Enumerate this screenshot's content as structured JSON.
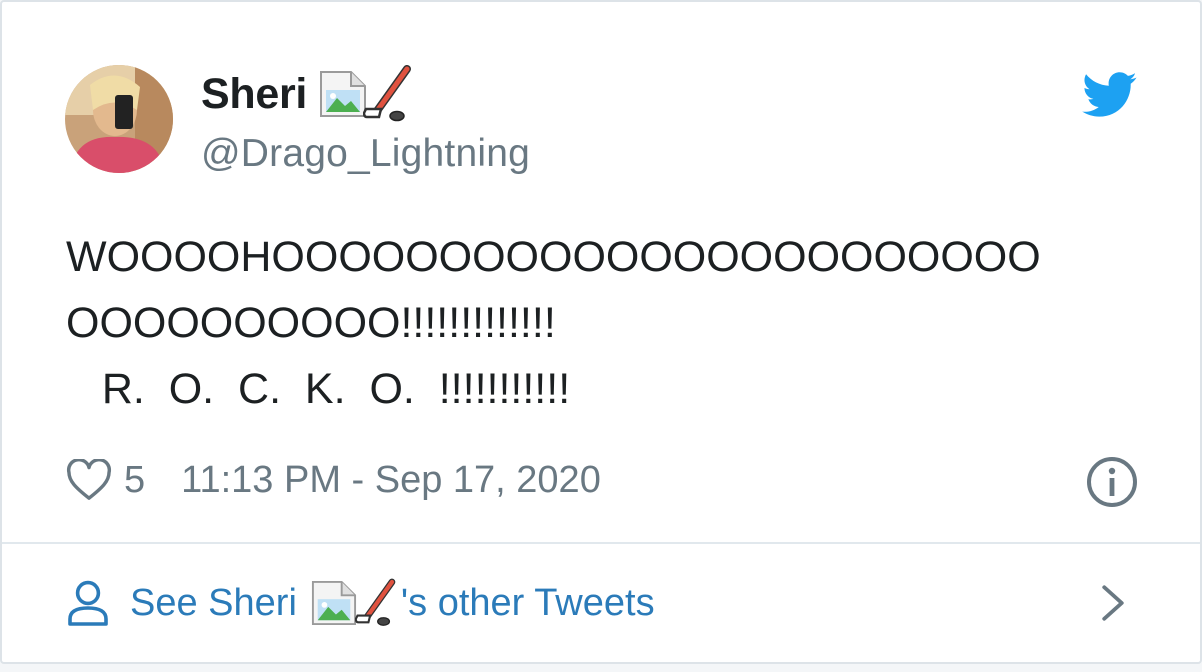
{
  "author": {
    "display_name": "Sheri",
    "handle": "@Drago_Lightning"
  },
  "tweet": {
    "lines": [
      "WOOOOHOOOOOOOOOOOOOOOOOOOOOOO",
      "OOOOOOOOOO!!!!!!!!!!!!!",
      "   R.  O.  C.  K.  O.  !!!!!!!!!!!"
    ],
    "likes": "5",
    "timestamp": "11:13 PM - Sep 17, 2020"
  },
  "footer": {
    "link_prefix": "See Sheri",
    "link_suffix": "'s other Tweets"
  },
  "icons": {
    "brand": "twitter-bird-icon",
    "like": "heart-icon",
    "info": "info-icon",
    "profile": "person-icon",
    "next": "chevron-right-icon",
    "emoji": "ice-hockey-icon",
    "missing_image": "broken-image-icon"
  },
  "colors": {
    "text": "#1c2022",
    "secondary": "#697882",
    "link": "#2b7bb9",
    "brand": "#1da1f2",
    "border": "#e1e8ed"
  }
}
